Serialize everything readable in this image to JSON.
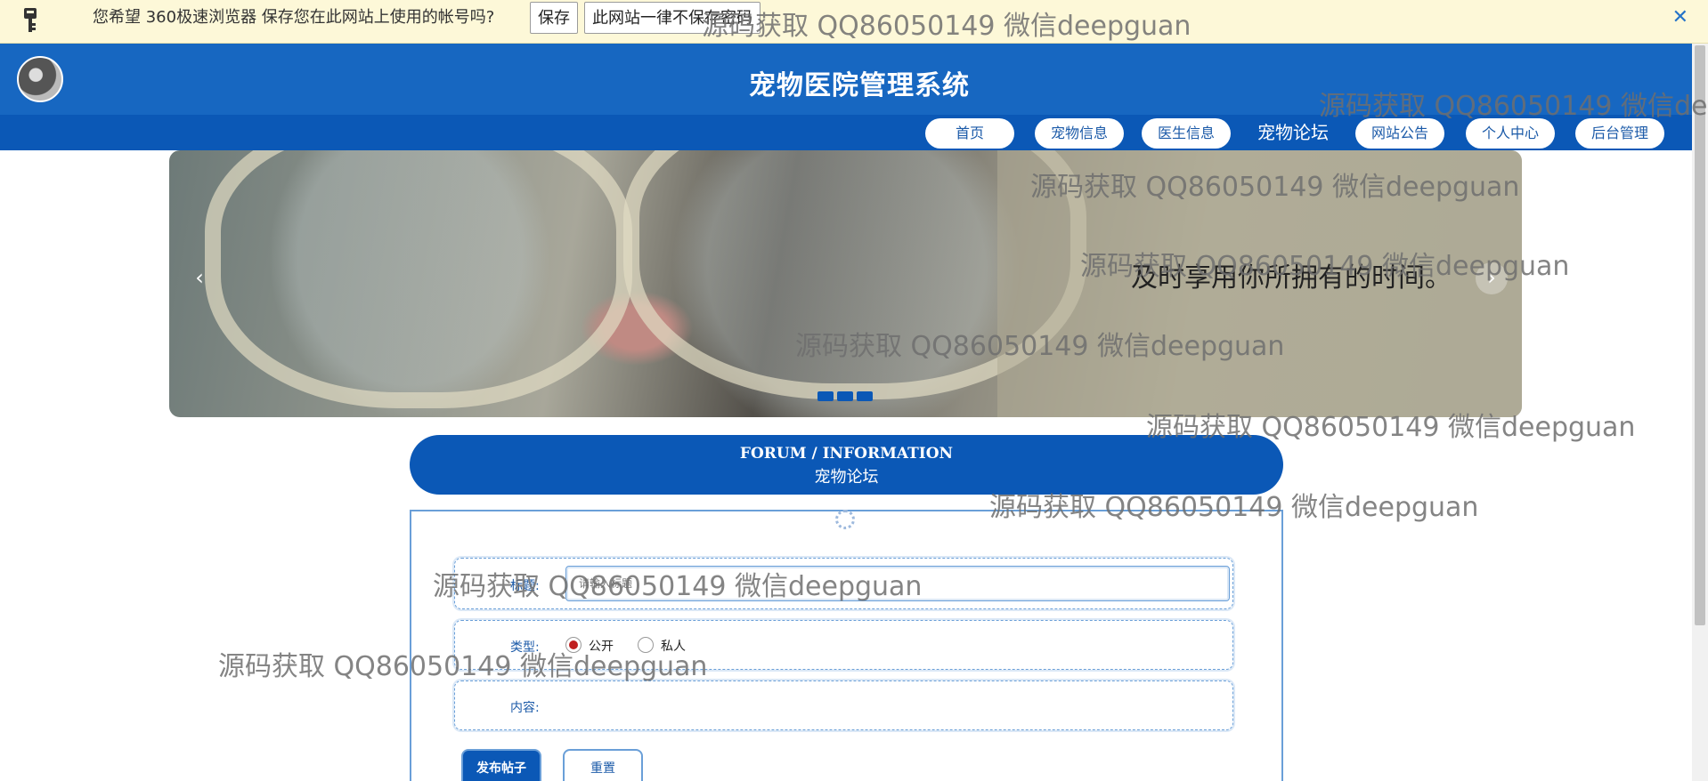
{
  "browser_bar": {
    "message": "您希望 360极速浏览器 保存您在此网站上使用的帐号吗?",
    "save_label": "保存",
    "never_label": "此网站一律不保存密码",
    "close_glyph": "✕"
  },
  "site": {
    "title": "宠物医院管理系统"
  },
  "nav": {
    "items": [
      "首页",
      "宠物信息",
      "医生信息",
      "宠物论坛",
      "网站公告",
      "个人中心",
      "后台管理"
    ],
    "active_index": 3
  },
  "banner": {
    "caption": "及时享用你所拥有的时间。",
    "prev_glyph": "‹",
    "next_glyph": "›",
    "slide_count": 3
  },
  "section": {
    "title_en": "FORUM / INFORMATION",
    "title_zh": "宠物论坛"
  },
  "form": {
    "title_label": "标题:",
    "title_placeholder": "请输入标题",
    "type_label": "类型:",
    "type_options": [
      "公开",
      "私人"
    ],
    "type_selected": "公开",
    "content_label": "内容:",
    "submit_label": "发布帖子",
    "reset_label": "重置"
  },
  "watermark": "源码获取 QQ86050149 微信deepguan",
  "colors": {
    "primary": "#0b58b6",
    "header": "#1767c1",
    "browser_bar": "#fdf8d8",
    "accent_radio": "#c01f1f"
  }
}
